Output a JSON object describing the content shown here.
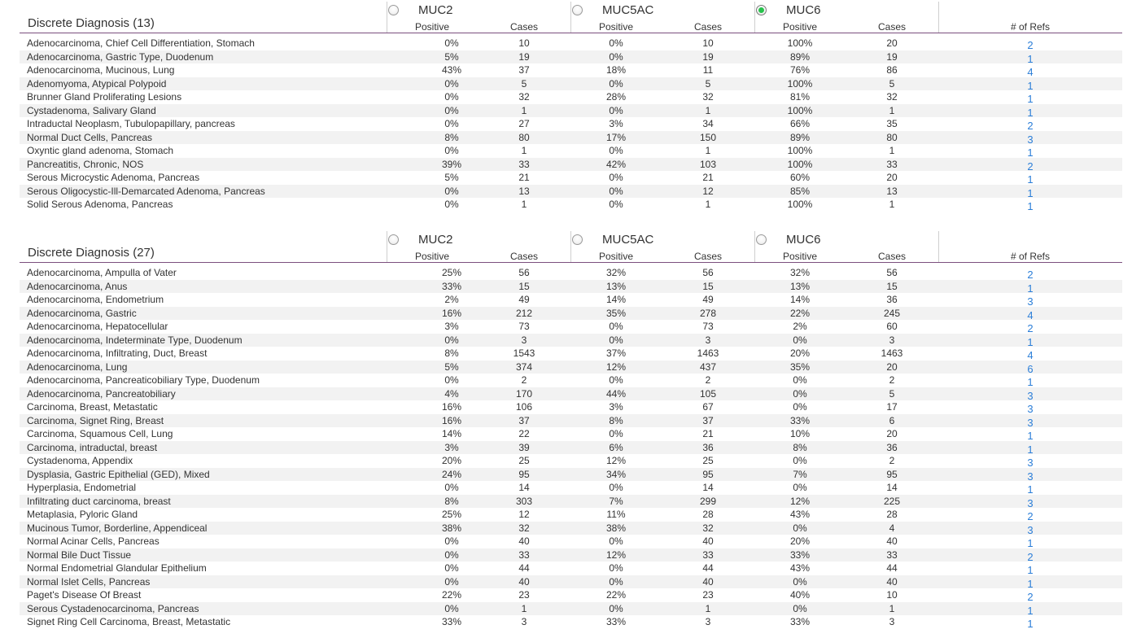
{
  "sections": [
    {
      "title": "Discrete Diagnosis (13)",
      "genes": [
        {
          "name": "MUC2",
          "selected": false
        },
        {
          "name": "MUC5AC",
          "selected": false
        },
        {
          "name": "MUC6",
          "selected": true
        }
      ],
      "subheaders": {
        "positive": "Positive",
        "cases": "Cases",
        "refs": "# of Refs"
      },
      "rows": [
        [
          "Adenocarcinoma, Chief Cell Differentiation, Stomach",
          "0%",
          "10",
          "0%",
          "10",
          "100%",
          "20",
          "2"
        ],
        [
          "Adenocarcinoma, Gastric Type, Duodenum",
          "5%",
          "19",
          "0%",
          "19",
          "89%",
          "19",
          "1"
        ],
        [
          "Adenocarcinoma, Mucinous, Lung",
          "43%",
          "37",
          "18%",
          "11",
          "76%",
          "86",
          "4"
        ],
        [
          "Adenomyoma, Atypical Polypoid",
          "0%",
          "5",
          "0%",
          "5",
          "100%",
          "5",
          "1"
        ],
        [
          "Brunner Gland Proliferating Lesions",
          "0%",
          "32",
          "28%",
          "32",
          "81%",
          "32",
          "1"
        ],
        [
          "Cystadenoma, Salivary Gland",
          "0%",
          "1",
          "0%",
          "1",
          "100%",
          "1",
          "1"
        ],
        [
          "Intraductal Neoplasm, Tubulopapillary, pancreas",
          "0%",
          "27",
          "3%",
          "34",
          "66%",
          "35",
          "2"
        ],
        [
          "Normal Duct Cells, Pancreas",
          "8%",
          "80",
          "17%",
          "150",
          "89%",
          "80",
          "3"
        ],
        [
          "Oxyntic gland adenoma, Stomach",
          "0%",
          "1",
          "0%",
          "1",
          "100%",
          "1",
          "1"
        ],
        [
          "Pancreatitis, Chronic, NOS",
          "39%",
          "33",
          "42%",
          "103",
          "100%",
          "33",
          "2"
        ],
        [
          "Serous Microcystic Adenoma, Pancreas",
          "5%",
          "21",
          "0%",
          "21",
          "60%",
          "20",
          "1"
        ],
        [
          "Serous Oligocystic-Ill-Demarcated Adenoma, Pancreas",
          "0%",
          "13",
          "0%",
          "12",
          "85%",
          "13",
          "1"
        ],
        [
          "Solid Serous Adenoma, Pancreas",
          "0%",
          "1",
          "0%",
          "1",
          "100%",
          "1",
          "1"
        ]
      ]
    },
    {
      "title": "Discrete Diagnosis (27)",
      "genes": [
        {
          "name": "MUC2",
          "selected": false
        },
        {
          "name": "MUC5AC",
          "selected": false
        },
        {
          "name": "MUC6",
          "selected": false
        }
      ],
      "subheaders": {
        "positive": "Positive",
        "cases": "Cases",
        "refs": "# of Refs"
      },
      "rows": [
        [
          "Adenocarcinoma, Ampulla of Vater",
          "25%",
          "56",
          "32%",
          "56",
          "32%",
          "56",
          "2"
        ],
        [
          "Adenocarcinoma, Anus",
          "33%",
          "15",
          "13%",
          "15",
          "13%",
          "15",
          "1"
        ],
        [
          "Adenocarcinoma, Endometrium",
          "2%",
          "49",
          "14%",
          "49",
          "14%",
          "36",
          "3"
        ],
        [
          "Adenocarcinoma, Gastric",
          "16%",
          "212",
          "35%",
          "278",
          "22%",
          "245",
          "4"
        ],
        [
          "Adenocarcinoma, Hepatocellular",
          "3%",
          "73",
          "0%",
          "73",
          "2%",
          "60",
          "2"
        ],
        [
          "Adenocarcinoma, Indeterminate Type, Duodenum",
          "0%",
          "3",
          "0%",
          "3",
          "0%",
          "3",
          "1"
        ],
        [
          "Adenocarcinoma, Infiltrating, Duct, Breast",
          "8%",
          "1543",
          "37%",
          "1463",
          "20%",
          "1463",
          "4"
        ],
        [
          "Adenocarcinoma, Lung",
          "5%",
          "374",
          "12%",
          "437",
          "35%",
          "20",
          "6"
        ],
        [
          "Adenocarcinoma, Pancreaticobiliary Type, Duodenum",
          "0%",
          "2",
          "0%",
          "2",
          "0%",
          "2",
          "1"
        ],
        [
          "Adenocarcinoma, Pancreatobiliary",
          "4%",
          "170",
          "44%",
          "105",
          "0%",
          "5",
          "3"
        ],
        [
          "Carcinoma, Breast, Metastatic",
          "16%",
          "106",
          "3%",
          "67",
          "0%",
          "17",
          "3"
        ],
        [
          "Carcinoma, Signet Ring, Breast",
          "16%",
          "37",
          "8%",
          "37",
          "33%",
          "6",
          "3"
        ],
        [
          "Carcinoma, Squamous Cell, Lung",
          "14%",
          "22",
          "0%",
          "21",
          "10%",
          "20",
          "1"
        ],
        [
          "Carcinoma, intraductal, breast",
          "3%",
          "39",
          "6%",
          "36",
          "8%",
          "36",
          "1"
        ],
        [
          "Cystadenoma, Appendix",
          "20%",
          "25",
          "12%",
          "25",
          "0%",
          "2",
          "3"
        ],
        [
          "Dysplasia, Gastric Epithelial (GED), Mixed",
          "24%",
          "95",
          "34%",
          "95",
          "7%",
          "95",
          "3"
        ],
        [
          "Hyperplasia, Endometrial",
          "0%",
          "14",
          "0%",
          "14",
          "0%",
          "14",
          "1"
        ],
        [
          "Infiltrating duct carcinoma, breast",
          "8%",
          "303",
          "7%",
          "299",
          "12%",
          "225",
          "3"
        ],
        [
          "Metaplasia, Pyloric Gland",
          "25%",
          "12",
          "11%",
          "28",
          "43%",
          "28",
          "2"
        ],
        [
          "Mucinous Tumor, Borderline, Appendiceal",
          "38%",
          "32",
          "38%",
          "32",
          "0%",
          "4",
          "3"
        ],
        [
          "Normal Acinar Cells, Pancreas",
          "0%",
          "40",
          "0%",
          "40",
          "20%",
          "40",
          "1"
        ],
        [
          "Normal Bile Duct Tissue",
          "0%",
          "33",
          "12%",
          "33",
          "33%",
          "33",
          "2"
        ],
        [
          "Normal Endometrial Glandular Epithelium",
          "0%",
          "44",
          "0%",
          "44",
          "43%",
          "44",
          "1"
        ],
        [
          "Normal Islet Cells, Pancreas",
          "0%",
          "40",
          "0%",
          "40",
          "0%",
          "40",
          "1"
        ],
        [
          "Paget's Disease Of Breast",
          "22%",
          "23",
          "22%",
          "23",
          "40%",
          "10",
          "2"
        ],
        [
          "Serous Cystadenocarcinoma, Pancreas",
          "0%",
          "1",
          "0%",
          "1",
          "0%",
          "1",
          "1"
        ],
        [
          "Signet Ring Cell Carcinoma, Breast, Metastatic",
          "33%",
          "3",
          "33%",
          "3",
          "33%",
          "3",
          "1"
        ]
      ]
    }
  ]
}
